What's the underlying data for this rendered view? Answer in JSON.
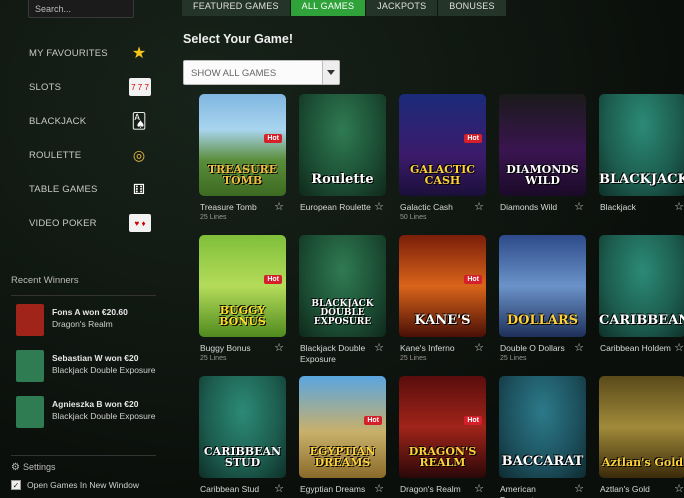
{
  "search": {
    "placeholder": "Search..."
  },
  "sidebar": {
    "items": [
      {
        "label": "MY FAVOURITES",
        "icon": "star-icon"
      },
      {
        "label": "SLOTS",
        "icon": "slot-machine-icon"
      },
      {
        "label": "BLACKJACK",
        "icon": "playing-cards-icon"
      },
      {
        "label": "ROULETTE",
        "icon": "roulette-chips-icon"
      },
      {
        "label": "TABLE GAMES",
        "icon": "dice-icon"
      },
      {
        "label": "VIDEO POKER",
        "icon": "poker-cards-icon"
      }
    ]
  },
  "winners": {
    "title": "Recent Winners",
    "items": [
      {
        "name": "Fons A won €20.60",
        "game": "Dragon's Realm",
        "color": "#a0241a"
      },
      {
        "name": "Sebastian W won €20",
        "game": "Blackjack Double Exposure",
        "color": "#2f7b52"
      },
      {
        "name": "Agnieszka B won €20",
        "game": "Blackjack Double Exposure",
        "color": "#2f7b52"
      }
    ]
  },
  "settings": {
    "title": "Settings",
    "open_new_window": "Open Games In New Window",
    "open_new_window_checked": true
  },
  "tabs": [
    {
      "label": "FEATURED GAMES",
      "active": false
    },
    {
      "label": "ALL GAMES",
      "active": true
    },
    {
      "label": "JACKPOTS",
      "active": false
    },
    {
      "label": "BONUSES",
      "active": false
    }
  ],
  "main": {
    "title": "Select Your Game!",
    "filter": {
      "selected": "SHOW ALL GAMES"
    }
  },
  "games": [
    {
      "name": "Treasure Tomb",
      "lines": "25 Lines",
      "hot": true,
      "art": "TREASURE TOMB",
      "art_color": "#f0c040"
    },
    {
      "name": "European Roulette",
      "lines": "",
      "hot": false,
      "art": "Roulette",
      "art_color": "#ffffff"
    },
    {
      "name": "Galactic Cash",
      "lines": "50 Lines",
      "hot": true,
      "art": "GALACTIC CASH",
      "art_color": "#ffd23a"
    },
    {
      "name": "Diamonds Wild",
      "lines": "",
      "hot": false,
      "art": "DIAMONDS WILD",
      "art_color": "#ffffff"
    },
    {
      "name": "Blackjack",
      "lines": "",
      "hot": false,
      "art": "BLACKJACK",
      "art_color": "#ffffff"
    },
    {
      "name": "Buggy Bonus",
      "lines": "25 Lines",
      "hot": true,
      "art": "BUGGY BONUS",
      "art_color": "#ffde2a"
    },
    {
      "name": "Blackjack Double Exposure",
      "lines": "",
      "hot": false,
      "art": "BLACKJACK DOUBLE EXPOSURE",
      "art_color": "#ffffff"
    },
    {
      "name": "Kane's Inferno",
      "lines": "25 Lines",
      "hot": true,
      "art": "KANE'S",
      "art_color": "#ffffff"
    },
    {
      "name": "Double O Dollars",
      "lines": "25 Lines",
      "hot": false,
      "art": "DOLLARS",
      "art_color": "#ffd23a"
    },
    {
      "name": "Caribbean Holdem",
      "lines": "",
      "hot": false,
      "art": "CARIBBEAN",
      "art_color": "#ffffff"
    },
    {
      "name": "Caribbean Stud",
      "lines": "",
      "hot": false,
      "art": "CARIBBEAN STUD",
      "art_color": "#ffffff"
    },
    {
      "name": "Egyptian Dreams",
      "lines": "",
      "hot": true,
      "art": "EGYPTIAN DREAMS",
      "art_color": "#ffd23a"
    },
    {
      "name": "Dragon's Realm",
      "lines": "",
      "hot": true,
      "art": "DRAGON'S REALM",
      "art_color": "#ffd23a"
    },
    {
      "name": "American Baccarat",
      "lines": "",
      "hot": false,
      "art": "BACCARAT",
      "art_color": "#ffffff"
    },
    {
      "name": "Aztlan's Gold",
      "lines": "",
      "hot": false,
      "art": "Aztlan's Gold",
      "art_color": "#ffd23a"
    }
  ]
}
